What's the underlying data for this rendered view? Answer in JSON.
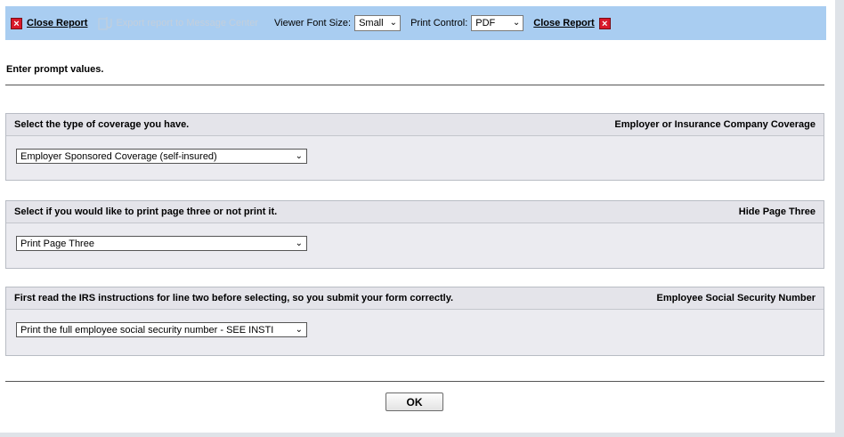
{
  "toolbar": {
    "close_report_left": "Close Report",
    "export_label": "Export report to Message Center",
    "font_size_label": "Viewer Font Size:",
    "font_size_value": "Small",
    "print_control_label": "Print Control:",
    "print_control_value": "PDF",
    "close_report_right": "Close Report"
  },
  "prompt_heading": "Enter prompt values.",
  "sections": [
    {
      "question": "Select the type of coverage you have.",
      "parameter": "Employer or Insurance Company Coverage",
      "selected": "Employer Sponsored Coverage (self-insured)"
    },
    {
      "question": "Select if you would like to print page three or not print it.",
      "parameter": "Hide Page Three",
      "selected": "Print Page Three"
    },
    {
      "question": "First read the IRS instructions for line two before selecting, so you submit your form correctly.",
      "parameter": "Employee Social Security Number",
      "selected": "Print the full employee social security number - SEE INSTI"
    }
  ],
  "ok_label": "OK",
  "colors": {
    "toolbar_bg": "#a9cdf1",
    "close_icon": "#d8182a",
    "section_bg": "#ebebf0"
  }
}
